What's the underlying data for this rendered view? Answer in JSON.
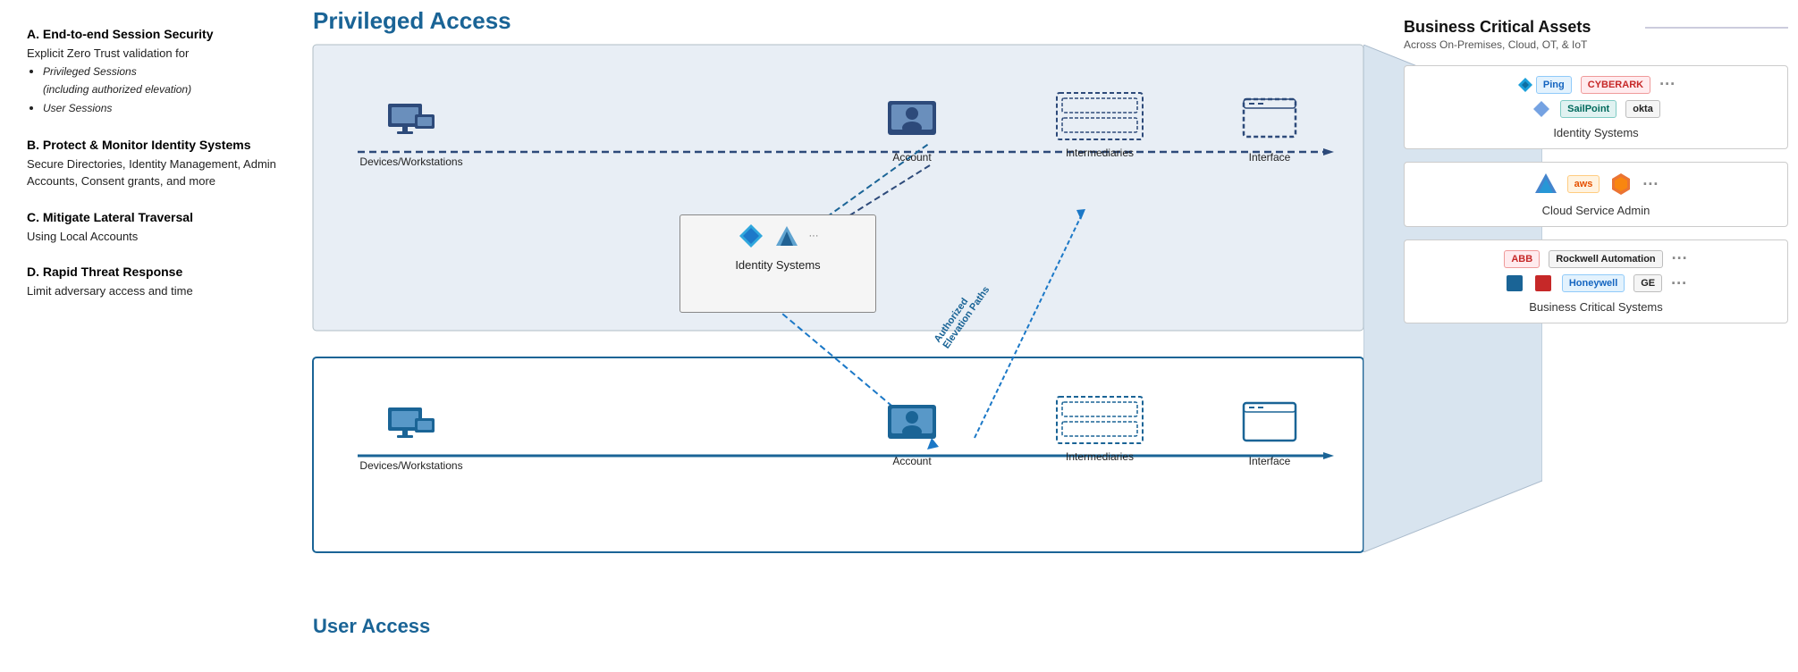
{
  "left": {
    "sections": [
      {
        "id": "A",
        "title": "A. End-to-end Session Security",
        "body": "Explicit Zero Trust validation for",
        "bullets": [
          {
            "text": "Privileged Sessions",
            "sub": "(including authorized elevation)"
          },
          {
            "text": "User Sessions",
            "sub": ""
          }
        ]
      },
      {
        "id": "B",
        "title": "B. Protect & Monitor Identity Systems",
        "body": "Secure Directories, Identity Management, Admin Accounts, Consent grants, and more",
        "bullets": []
      },
      {
        "id": "C",
        "title": "C. Mitigate Lateral Traversal",
        "body": "Using Local Accounts",
        "bullets": []
      },
      {
        "id": "D",
        "title": "D. Rapid Threat Response",
        "body": "Limit adversary access and time",
        "bullets": []
      }
    ]
  },
  "diagram": {
    "privileged_title": "Privileged Access",
    "user_access_title": "User Access",
    "nodes": {
      "priv_devices": "Devices/Workstations",
      "priv_account": "Account",
      "priv_intermediaries": "Intermediaries",
      "priv_interface": "Interface",
      "identity_systems": "Identity Systems",
      "user_devices": "Devices/Workstations",
      "user_account": "Account",
      "user_intermediaries": "Intermediaries",
      "user_interface": "Interface"
    },
    "elevation_label": "Authorized\nElevation Paths"
  },
  "right": {
    "title": "Business Critical Assets",
    "subtitle": "Across On-Premises, Cloud, OT, & IoT",
    "sections": [
      {
        "id": "identity",
        "logos": [
          "Ping",
          "CYBERARK",
          "SailPoint",
          "okta",
          "..."
        ],
        "label": "Identity Systems"
      },
      {
        "id": "cloud",
        "logos": [
          "Azure",
          "aws",
          "GCP",
          "..."
        ],
        "label": "Cloud Service Admin"
      },
      {
        "id": "critical",
        "logos": [
          "ABB",
          "Rockwell",
          "Honeywell",
          "GE",
          "..."
        ],
        "label": "Business Critical Systems"
      }
    ]
  }
}
